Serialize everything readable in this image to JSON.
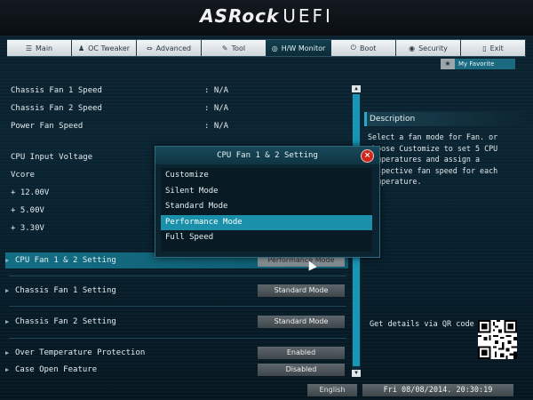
{
  "header": {
    "brand": "ASRock",
    "product": "UEFI"
  },
  "nav": {
    "tabs": [
      {
        "label": "Main",
        "icon": "menu-icon",
        "active": false
      },
      {
        "label": "OC Tweaker",
        "icon": "person-icon",
        "active": false
      },
      {
        "label": "Advanced",
        "icon": "list-icon",
        "active": false
      },
      {
        "label": "Tool",
        "icon": "wrench-icon",
        "active": false
      },
      {
        "label": "H/W Monitor",
        "icon": "monitor-icon",
        "active": true
      },
      {
        "label": "Boot",
        "icon": "power-icon",
        "active": false
      },
      {
        "label": "Security",
        "icon": "shield-icon",
        "active": false
      },
      {
        "label": "Exit",
        "icon": "exit-icon",
        "active": false
      }
    ]
  },
  "favorite": {
    "label": "My Favorite",
    "icon": "star-icon"
  },
  "readings": [
    {
      "label": "Chassis Fan 1 Speed",
      "value": ": N/A"
    },
    {
      "label": "Chassis Fan 2 Speed",
      "value": ": N/A"
    },
    {
      "label": "Power Fan Speed",
      "value": ": N/A"
    },
    {
      "label": "CPU Input Voltage",
      "value": ""
    },
    {
      "label": "Vcore",
      "value": ""
    },
    {
      "label": "+ 12.00V",
      "value": ""
    },
    {
      "label": "+ 5.00V",
      "value": ""
    },
    {
      "label": "+ 3.30V",
      "value": ""
    }
  ],
  "settings": [
    {
      "label": "CPU Fan 1 & 2 Setting",
      "value": "Performance Mode",
      "highlighted": true
    },
    {
      "label": "Chassis Fan 1 Setting",
      "value": "Standard Mode",
      "highlighted": false
    },
    {
      "label": "Chassis Fan 2 Setting",
      "value": "Standard Mode",
      "highlighted": false
    },
    {
      "label": "Over Temperature Protection",
      "value": "Enabled",
      "highlighted": false
    },
    {
      "label": "Case Open Feature",
      "value": "Disabled",
      "highlighted": false
    }
  ],
  "description": {
    "title": "Description",
    "text": "Select a fan mode for Fan. or choose Customize to set 5 CPU temperatures and assign a respective fan speed for each temperature.",
    "qr_label": "Get details via QR code"
  },
  "popup": {
    "title": "CPU Fan 1 & 2 Setting",
    "options": [
      "Customize",
      "Silent Mode",
      "Standard Mode",
      "Performance Mode",
      "Full Speed"
    ],
    "selected_index": 3
  },
  "footer": {
    "language": "English",
    "datetime": "Fri 08/08/2014. 20:30:19"
  },
  "colors": {
    "accent": "#1a90aa",
    "close": "#d0261c",
    "background": "#081722"
  }
}
